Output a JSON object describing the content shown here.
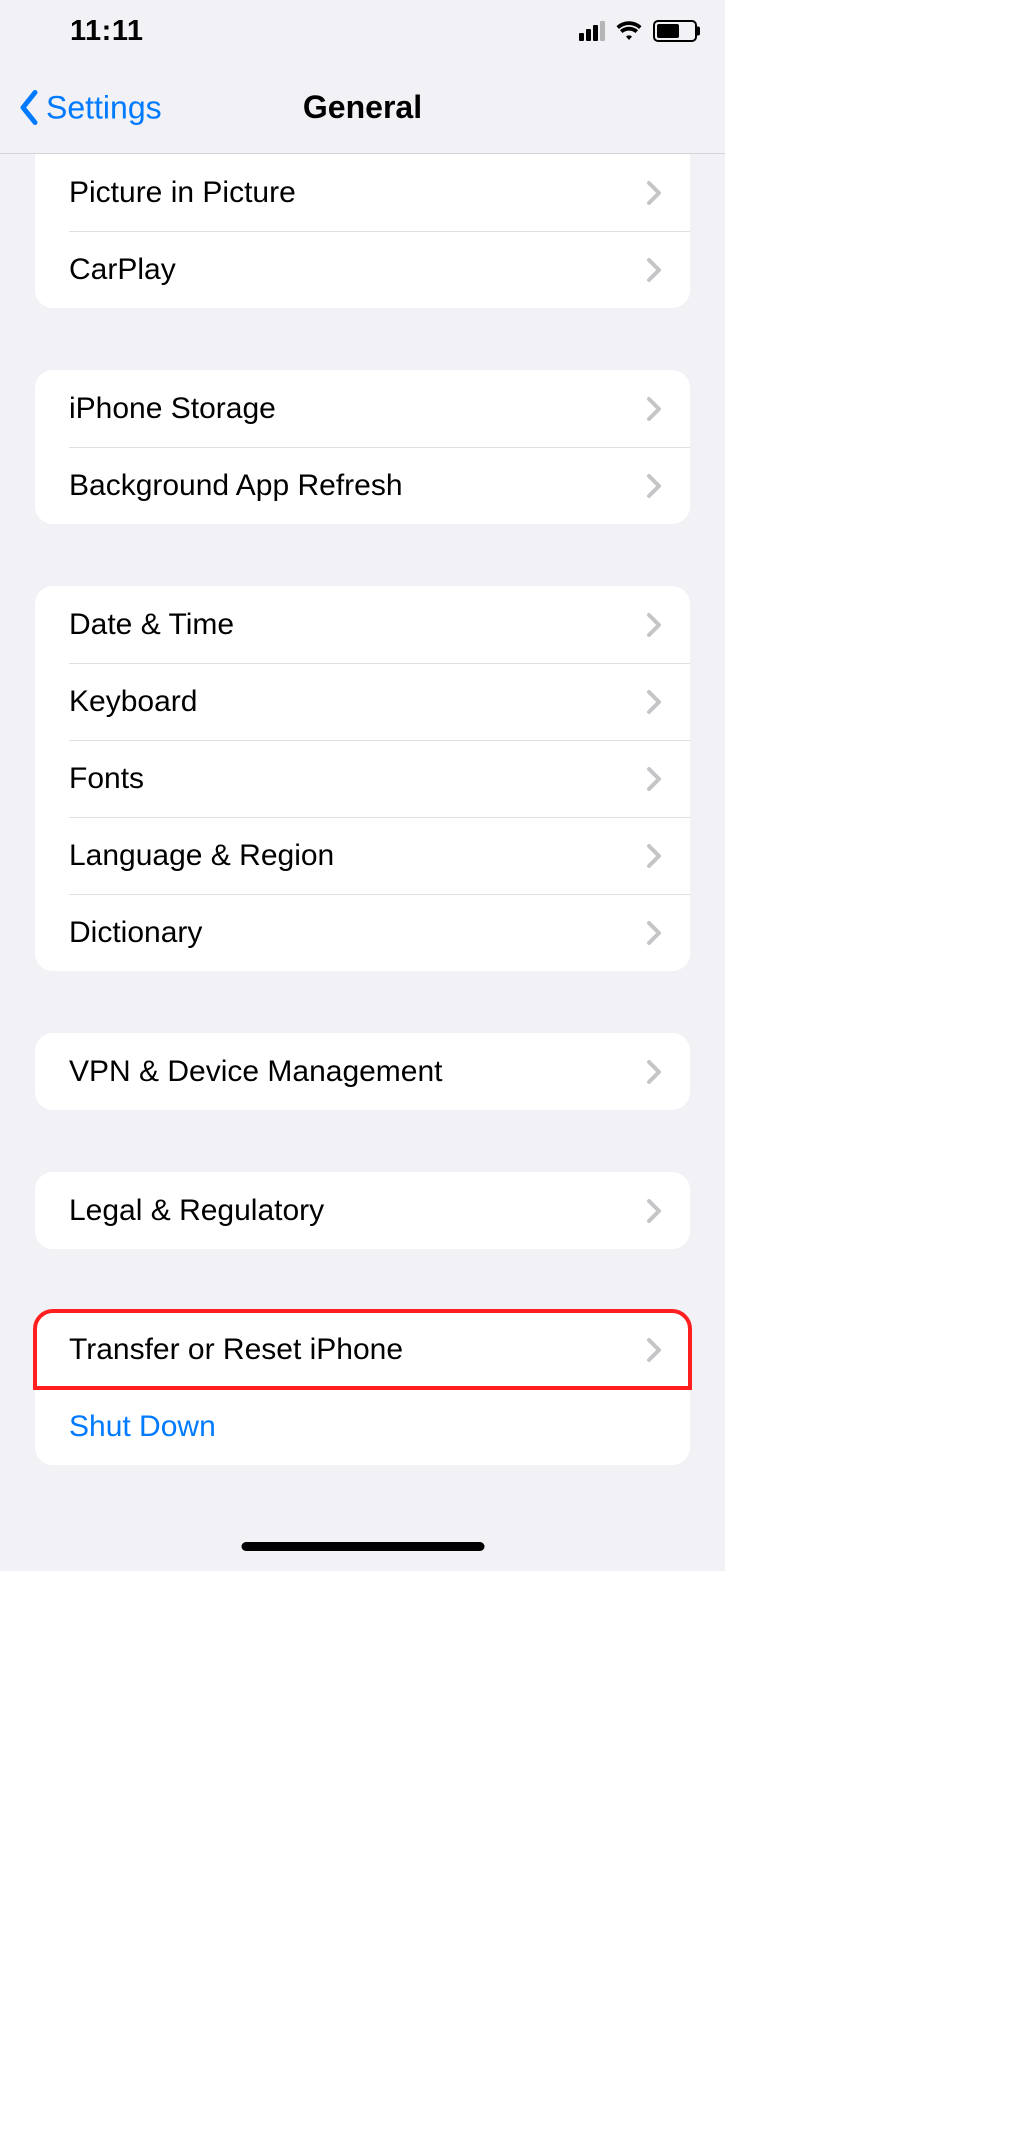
{
  "status": {
    "time": "11:11",
    "battery_pct": 62
  },
  "nav": {
    "back_label": "Settings",
    "title": "General"
  },
  "groups": [
    {
      "id": "g0",
      "rows": [
        {
          "name": "picture-in-picture",
          "label": "Picture in Picture",
          "chevron": true
        },
        {
          "name": "carplay",
          "label": "CarPlay",
          "chevron": true
        }
      ]
    },
    {
      "id": "g1",
      "rows": [
        {
          "name": "iphone-storage",
          "label": "iPhone Storage",
          "chevron": true
        },
        {
          "name": "background-app-refresh",
          "label": "Background App Refresh",
          "chevron": true
        }
      ]
    },
    {
      "id": "g2",
      "rows": [
        {
          "name": "date-time",
          "label": "Date & Time",
          "chevron": true
        },
        {
          "name": "keyboard",
          "label": "Keyboard",
          "chevron": true
        },
        {
          "name": "fonts",
          "label": "Fonts",
          "chevron": true
        },
        {
          "name": "language-region",
          "label": "Language & Region",
          "chevron": true
        },
        {
          "name": "dictionary",
          "label": "Dictionary",
          "chevron": true
        }
      ]
    },
    {
      "id": "g3",
      "rows": [
        {
          "name": "vpn-device-management",
          "label": "VPN & Device Management",
          "chevron": true
        }
      ]
    },
    {
      "id": "g4",
      "rows": [
        {
          "name": "legal-regulatory",
          "label": "Legal & Regulatory",
          "chevron": true
        }
      ]
    },
    {
      "id": "g5",
      "rows": [
        {
          "name": "transfer-reset",
          "label": "Transfer or Reset iPhone",
          "chevron": true,
          "highlighted": true
        },
        {
          "name": "shut-down",
          "label": "Shut Down",
          "link": true,
          "chevron": false
        }
      ]
    }
  ]
}
